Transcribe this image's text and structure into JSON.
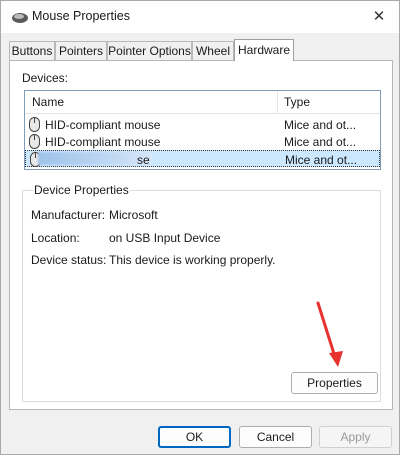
{
  "window": {
    "title": "Mouse Properties",
    "close_glyph": "✕"
  },
  "tabs": [
    {
      "label": "Buttons"
    },
    {
      "label": "Pointers"
    },
    {
      "label": "Pointer Options"
    },
    {
      "label": "Wheel"
    },
    {
      "label": "Hardware",
      "active": true
    }
  ],
  "hardware": {
    "devices_label": "Devices:",
    "columns": {
      "name": "Name",
      "type": "Type"
    },
    "devices": [
      {
        "name": "HID-compliant mouse",
        "type": "Mice and ot..."
      },
      {
        "name": "HID-compliant mouse",
        "type": "Mice and ot..."
      },
      {
        "name": "se",
        "type": "Mice and ot...",
        "selected": true
      }
    ],
    "device_properties": {
      "title": "Device Properties",
      "manufacturer_label": "Manufacturer:",
      "manufacturer_value": "Microsoft",
      "location_label": "Location:",
      "location_value": "on USB Input Device",
      "status_label": "Device status:",
      "status_value": "This device is working properly.",
      "properties_button": "Properties"
    }
  },
  "footer": {
    "ok": "OK",
    "cancel": "Cancel",
    "apply": "Apply"
  },
  "colors": {
    "selection": "#cce8ff",
    "accent": "#0067c0",
    "annotation_arrow": "#e8322f"
  }
}
